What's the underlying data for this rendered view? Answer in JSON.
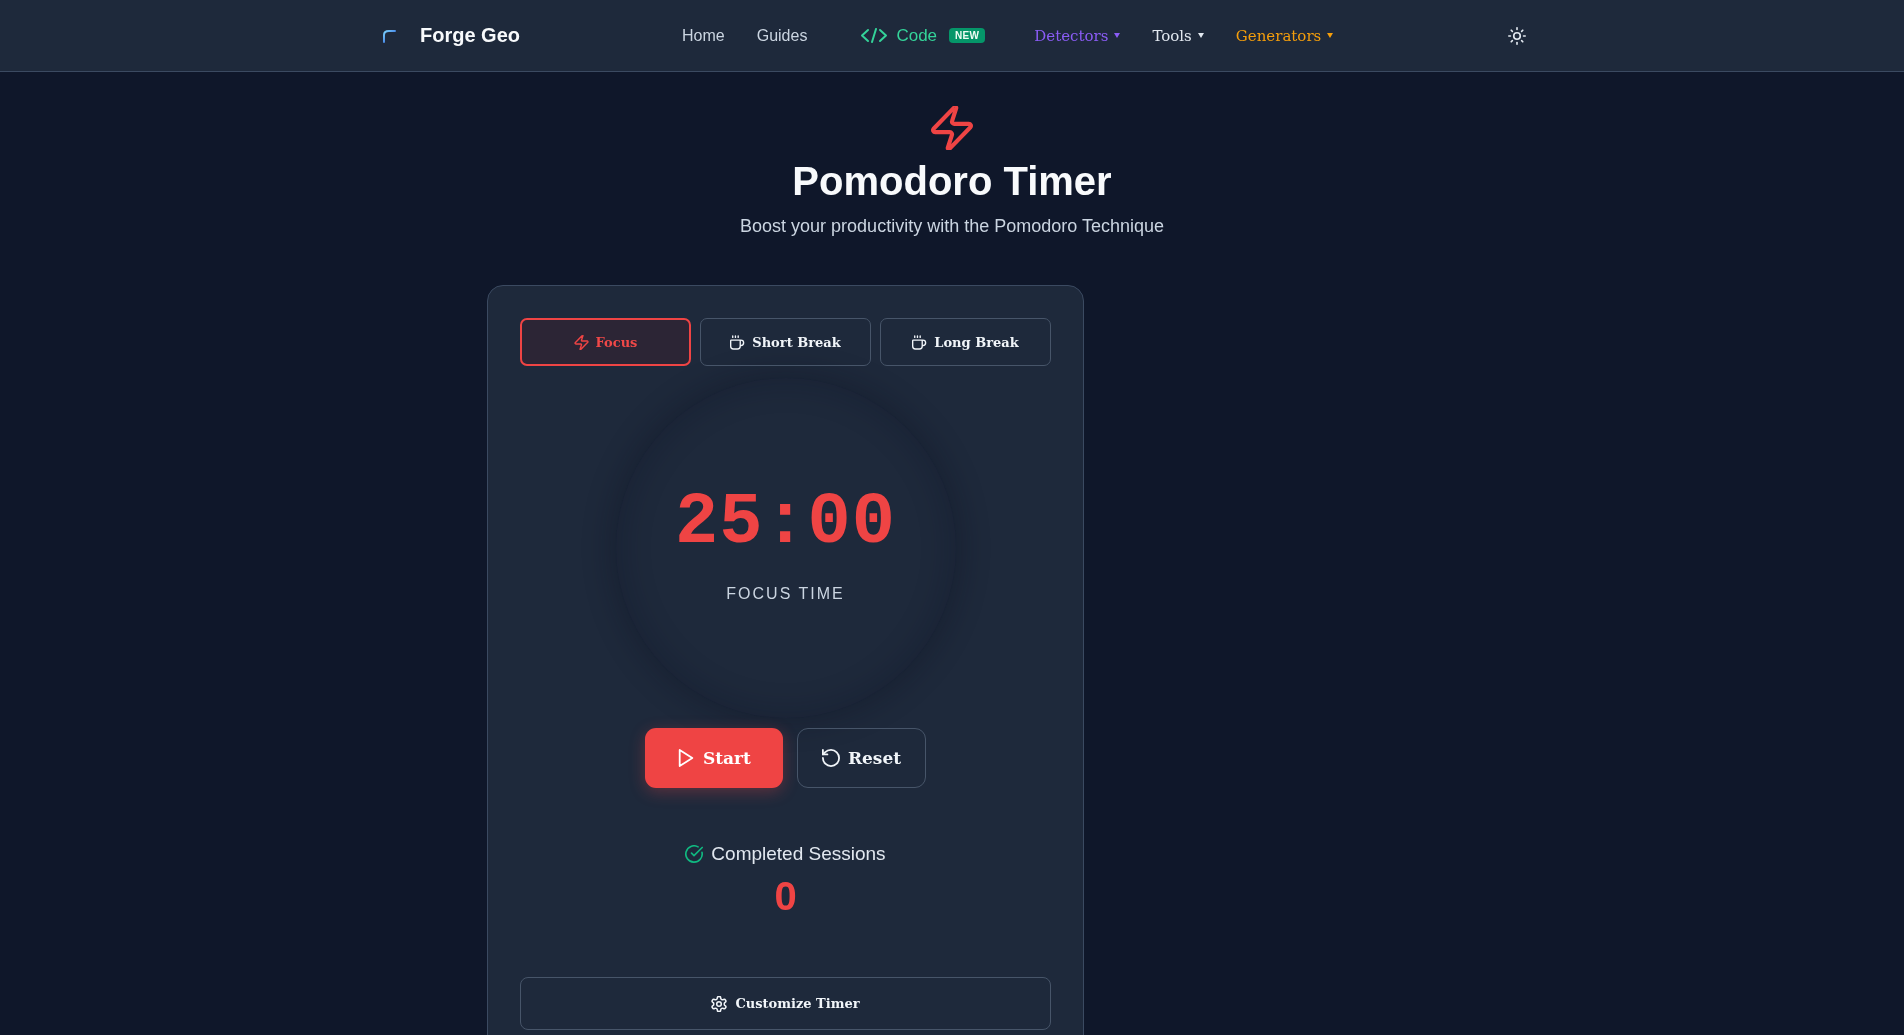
{
  "header": {
    "brand": "Forge Geo",
    "nav": [
      {
        "label": "Home",
        "kind": "link",
        "color": "#cbd5e1"
      },
      {
        "label": "Guides",
        "kind": "link",
        "color": "#cbd5e1"
      },
      {
        "label": "Code",
        "kind": "code",
        "color": "#34d399",
        "badge": "NEW"
      },
      {
        "label": "Detectors",
        "kind": "menu",
        "color": "#8b5cf6"
      },
      {
        "label": "Tools",
        "kind": "menu",
        "color": "#e2e8f0"
      },
      {
        "label": "Generators",
        "kind": "menu",
        "color": "#f59e0b"
      }
    ]
  },
  "hero": {
    "title": "Pomodoro Timer",
    "subtitle": "Boost your productivity with the Pomodoro Technique"
  },
  "timer_card": {
    "tabs": [
      {
        "label": "Focus",
        "kind": "focus",
        "selected": true
      },
      {
        "label": "Short Break",
        "kind": "break",
        "selected": false
      },
      {
        "label": "Long Break",
        "kind": "break",
        "selected": false
      }
    ],
    "time": "25:00",
    "mode_label": "FOCUS TIME",
    "buttons": [
      {
        "label": "Start",
        "kind": "start"
      },
      {
        "label": "Reset",
        "kind": "reset"
      }
    ],
    "sessions": {
      "title": "Completed Sessions",
      "count": "0"
    },
    "customize": {
      "label": "Customize Timer"
    }
  }
}
